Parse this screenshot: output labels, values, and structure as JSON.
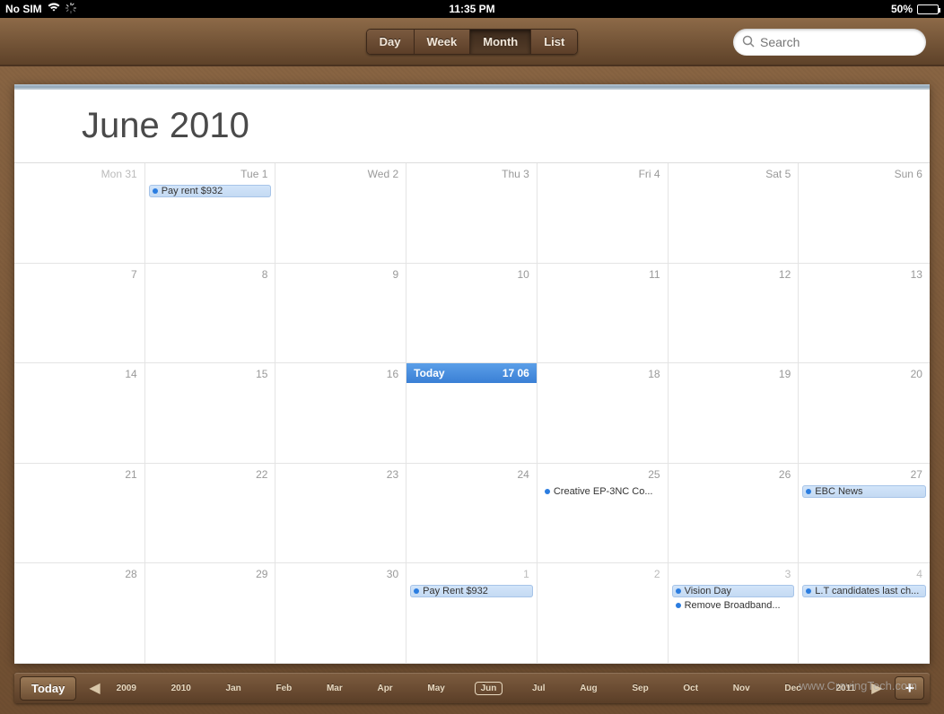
{
  "status": {
    "carrier": "No SIM",
    "time": "11:35 PM",
    "battery_pct": "50%"
  },
  "toolbar": {
    "tabs": [
      "Day",
      "Week",
      "Month",
      "List"
    ],
    "active_tab": "Month",
    "search_placeholder": "Search"
  },
  "calendar": {
    "title": "June 2010",
    "today_label": "Today",
    "today_date": "17 06",
    "weeks": [
      [
        {
          "label": "Mon 31",
          "other": true,
          "events": []
        },
        {
          "label": "Tue 1",
          "events": [
            {
              "title": "Pay rent $932",
              "light": true
            }
          ]
        },
        {
          "label": "Wed 2",
          "events": []
        },
        {
          "label": "Thu 3",
          "events": []
        },
        {
          "label": "Fri 4",
          "events": []
        },
        {
          "label": "Sat 5",
          "events": []
        },
        {
          "label": "Sun 6",
          "events": []
        }
      ],
      [
        {
          "label": "7",
          "events": []
        },
        {
          "label": "8",
          "events": []
        },
        {
          "label": "9",
          "events": []
        },
        {
          "label": "10",
          "events": []
        },
        {
          "label": "11",
          "events": []
        },
        {
          "label": "12",
          "events": []
        },
        {
          "label": "13",
          "events": []
        }
      ],
      [
        {
          "label": "14",
          "events": []
        },
        {
          "label": "15",
          "events": []
        },
        {
          "label": "16",
          "events": []
        },
        {
          "label": "17",
          "today": true,
          "events": []
        },
        {
          "label": "18",
          "events": []
        },
        {
          "label": "19",
          "events": []
        },
        {
          "label": "20",
          "events": []
        }
      ],
      [
        {
          "label": "21",
          "events": []
        },
        {
          "label": "22",
          "events": []
        },
        {
          "label": "23",
          "events": []
        },
        {
          "label": "24",
          "events": []
        },
        {
          "label": "25",
          "events": [
            {
              "title": "Creative EP-3NC Co..."
            }
          ]
        },
        {
          "label": "26",
          "events": []
        },
        {
          "label": "27",
          "events": [
            {
              "title": "EBC News",
              "light": true
            }
          ]
        }
      ],
      [
        {
          "label": "28",
          "events": []
        },
        {
          "label": "29",
          "events": []
        },
        {
          "label": "30",
          "events": []
        },
        {
          "label": "1",
          "other": true,
          "events": [
            {
              "title": "Pay Rent $932",
              "light": true
            }
          ]
        },
        {
          "label": "2",
          "other": true,
          "events": []
        },
        {
          "label": "3",
          "other": true,
          "events": [
            {
              "title": "Vision Day",
              "light": true
            },
            {
              "title": "Remove Broadband..."
            }
          ]
        },
        {
          "label": "4",
          "other": true,
          "events": [
            {
              "title": "L.T candidates last ch...",
              "light": true
            }
          ]
        }
      ]
    ]
  },
  "bottom": {
    "today_btn": "Today",
    "timeline": [
      "2009",
      "2010",
      "Jan",
      "Feb",
      "Mar",
      "Apr",
      "May",
      "Jun",
      "Jul",
      "Aug",
      "Sep",
      "Oct",
      "Nov",
      "Dec",
      "2011"
    ],
    "current": "Jun",
    "add_label": "+"
  },
  "watermark": "www.CravingTech.com"
}
